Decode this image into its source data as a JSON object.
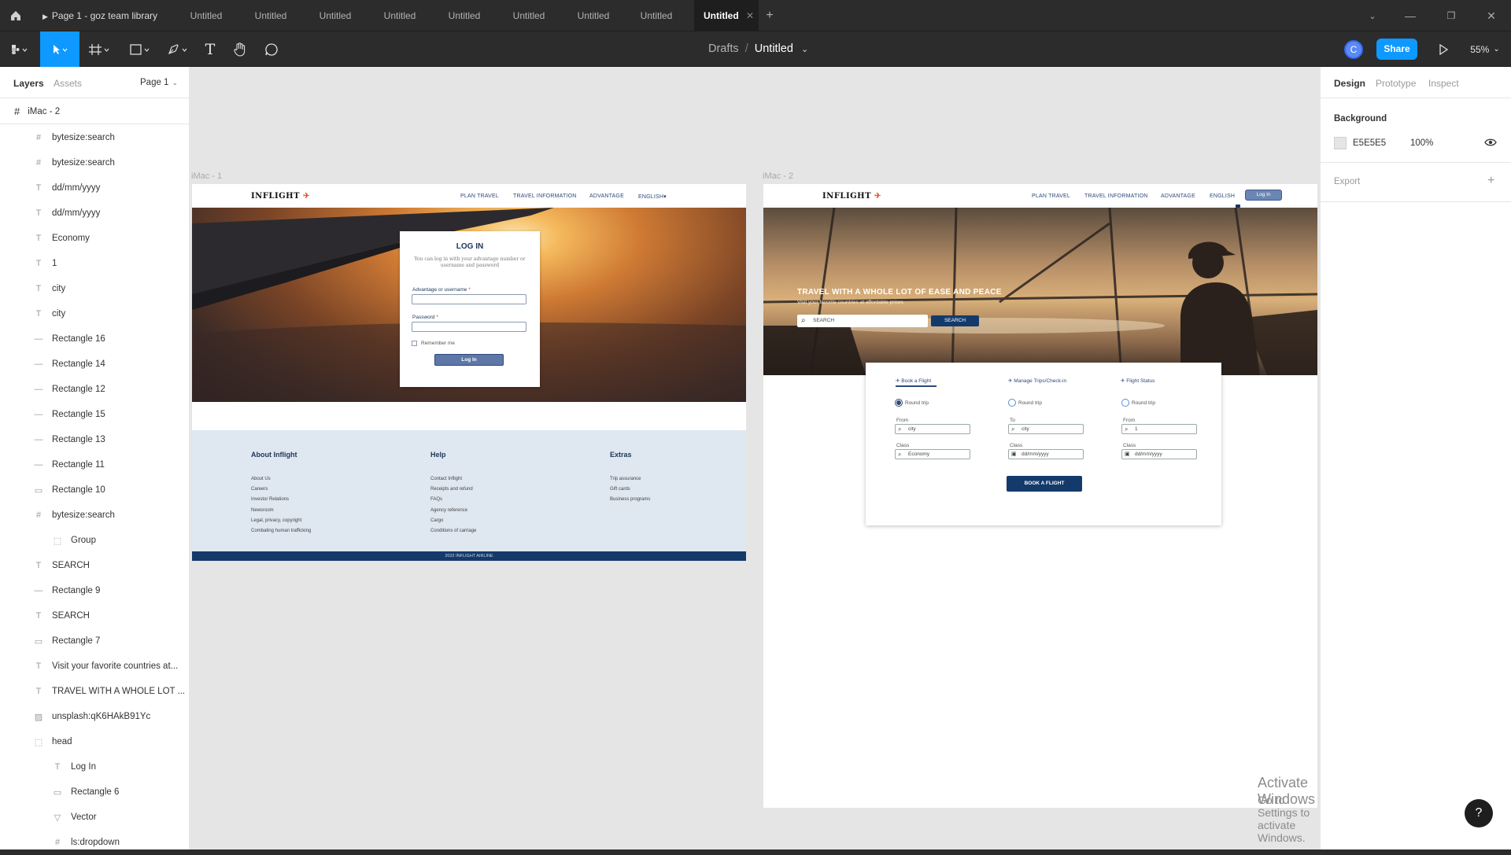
{
  "titlebar": {
    "tabs": [
      "Page 1 - goz team library",
      "Untitled",
      "Untitled",
      "Untitled",
      "Untitled",
      "Untitled",
      "Untitled",
      "Untitled",
      "Untitled",
      "Untitled"
    ],
    "add_tab": "+"
  },
  "toolbar": {
    "breadcrumb_parent": "Drafts",
    "breadcrumb_sep": "/",
    "file_name": "Untitled",
    "avatar_initial": "C",
    "share_label": "Share",
    "zoom": "55%"
  },
  "left_panel": {
    "tab_layers": "Layers",
    "tab_assets": "Assets",
    "page_select": "Page 1",
    "frame_name": "iMac - 2",
    "layers": [
      {
        "icon": "#",
        "name": "bytesize:search",
        "indent": 1
      },
      {
        "icon": "#",
        "name": "bytesize:search",
        "indent": 1
      },
      {
        "icon": "T",
        "name": "dd/mm/yyyy",
        "indent": 1
      },
      {
        "icon": "T",
        "name": "dd/mm/yyyy",
        "indent": 1
      },
      {
        "icon": "T",
        "name": "Economy",
        "indent": 1
      },
      {
        "icon": "T",
        "name": "1",
        "indent": 1
      },
      {
        "icon": "T",
        "name": "city",
        "indent": 1
      },
      {
        "icon": "T",
        "name": "city",
        "indent": 1
      },
      {
        "icon": "—",
        "name": "Rectangle 16",
        "indent": 1
      },
      {
        "icon": "—",
        "name": "Rectangle 14",
        "indent": 1
      },
      {
        "icon": "—",
        "name": "Rectangle 12",
        "indent": 1
      },
      {
        "icon": "—",
        "name": "Rectangle 15",
        "indent": 1
      },
      {
        "icon": "—",
        "name": "Rectangle 13",
        "indent": 1
      },
      {
        "icon": "—",
        "name": "Rectangle 11",
        "indent": 1
      },
      {
        "icon": "▭",
        "name": "Rectangle 10",
        "indent": 1
      },
      {
        "icon": "#",
        "name": "bytesize:search",
        "indent": 1
      },
      {
        "icon": "⬚",
        "name": "Group",
        "indent": 2
      },
      {
        "icon": "T",
        "name": "SEARCH",
        "indent": 1
      },
      {
        "icon": "—",
        "name": "Rectangle 9",
        "indent": 1
      },
      {
        "icon": "T",
        "name": "SEARCH",
        "indent": 1
      },
      {
        "icon": "▭",
        "name": "Rectangle 7",
        "indent": 1
      },
      {
        "icon": "T",
        "name": "Visit your favorite countries at...",
        "indent": 1
      },
      {
        "icon": "T",
        "name": "TRAVEL WITH A WHOLE LOT ...",
        "indent": 1
      },
      {
        "icon": "▨",
        "name": "unsplash:qK6HAkB91Yc",
        "indent": 1
      },
      {
        "icon": "⬚",
        "name": "head",
        "indent": 1
      },
      {
        "icon": "T",
        "name": "Log In",
        "indent": 2
      },
      {
        "icon": "▭",
        "name": "Rectangle 6",
        "indent": 2
      },
      {
        "icon": "▽",
        "name": "Vector",
        "indent": 2
      },
      {
        "icon": "#",
        "name": "ls:dropdown",
        "indent": 2
      }
    ]
  },
  "right_panel": {
    "tab_design": "Design",
    "tab_prototype": "Prototype",
    "tab_inspect": "Inspect",
    "background_label": "Background",
    "bg_hex": "E5E5E5",
    "bg_opacity": "100%",
    "export_label": "Export",
    "export_add": "+"
  },
  "canvas": {
    "frame1_label": "iMac - 1",
    "frame2_label": "iMac - 2",
    "activate_title": "Activate Windows",
    "activate_sub": "Go to Settings to activate Windows.",
    "help": "?"
  },
  "frame1": {
    "logo": "INFLIGHT",
    "nav": [
      "PLAN TRAVEL",
      "TRAVEL INFORMATION",
      "ADVANTAGE",
      "ENGLISH"
    ],
    "login_title": "LOG IN",
    "login_desc": "You can log in with your advantage number or username and password",
    "username_label": "Advantage or username",
    "password_label": "Password",
    "remember": "Remember me",
    "login_btn": "Log In",
    "footer_cols": [
      {
        "title": "About Inflight",
        "links": [
          "About Us",
          "Careers",
          "Investor Relations",
          "Newsroom",
          "Legal, privacy, copyright",
          "Combating human trafficking"
        ]
      },
      {
        "title": "Help",
        "links": [
          "Contact Inflight",
          "Receipts and refund",
          "FAQs",
          "Agency reference",
          "Cargo",
          "Conditions of carriage"
        ]
      },
      {
        "title": "Extras",
        "links": [
          "Trip assurance",
          "Gift cards",
          "Business programs"
        ]
      }
    ],
    "copyright": "2022 INFLIGHT AIRLINE"
  },
  "frame2": {
    "logo": "INFLIGHT",
    "nav": [
      "PLAN TRAVEL",
      "TRAVEL INFORMATION",
      "ADVANTAGE",
      "ENGLISH"
    ],
    "login_btn": "Log In",
    "hero_title": "TRAVEL WITH A WHOLE LOT OF EASE AND PEACE",
    "hero_sub": "Visit your favorite countries at affordable prices",
    "search_placeholder": "SEARCH",
    "search_btn": "SEARCH",
    "booking_tabs": [
      "Book a Flight",
      "Manage Trips/Check-in",
      "Flight Status"
    ],
    "round_trip": "Round trip",
    "col1": {
      "from_label": "From",
      "from_val": "city",
      "class_label": "Class",
      "class_val": "Economy"
    },
    "col2": {
      "to_label": "To",
      "to_val": "city",
      "class_label": "Class",
      "class_val": "dd/mm/yyyy"
    },
    "col3": {
      "from_label": "From",
      "from_val": "1",
      "class_label": "Class",
      "class_val": "dd/mm/yyyy"
    },
    "book_btn": "BOOK A FLIGHT"
  }
}
